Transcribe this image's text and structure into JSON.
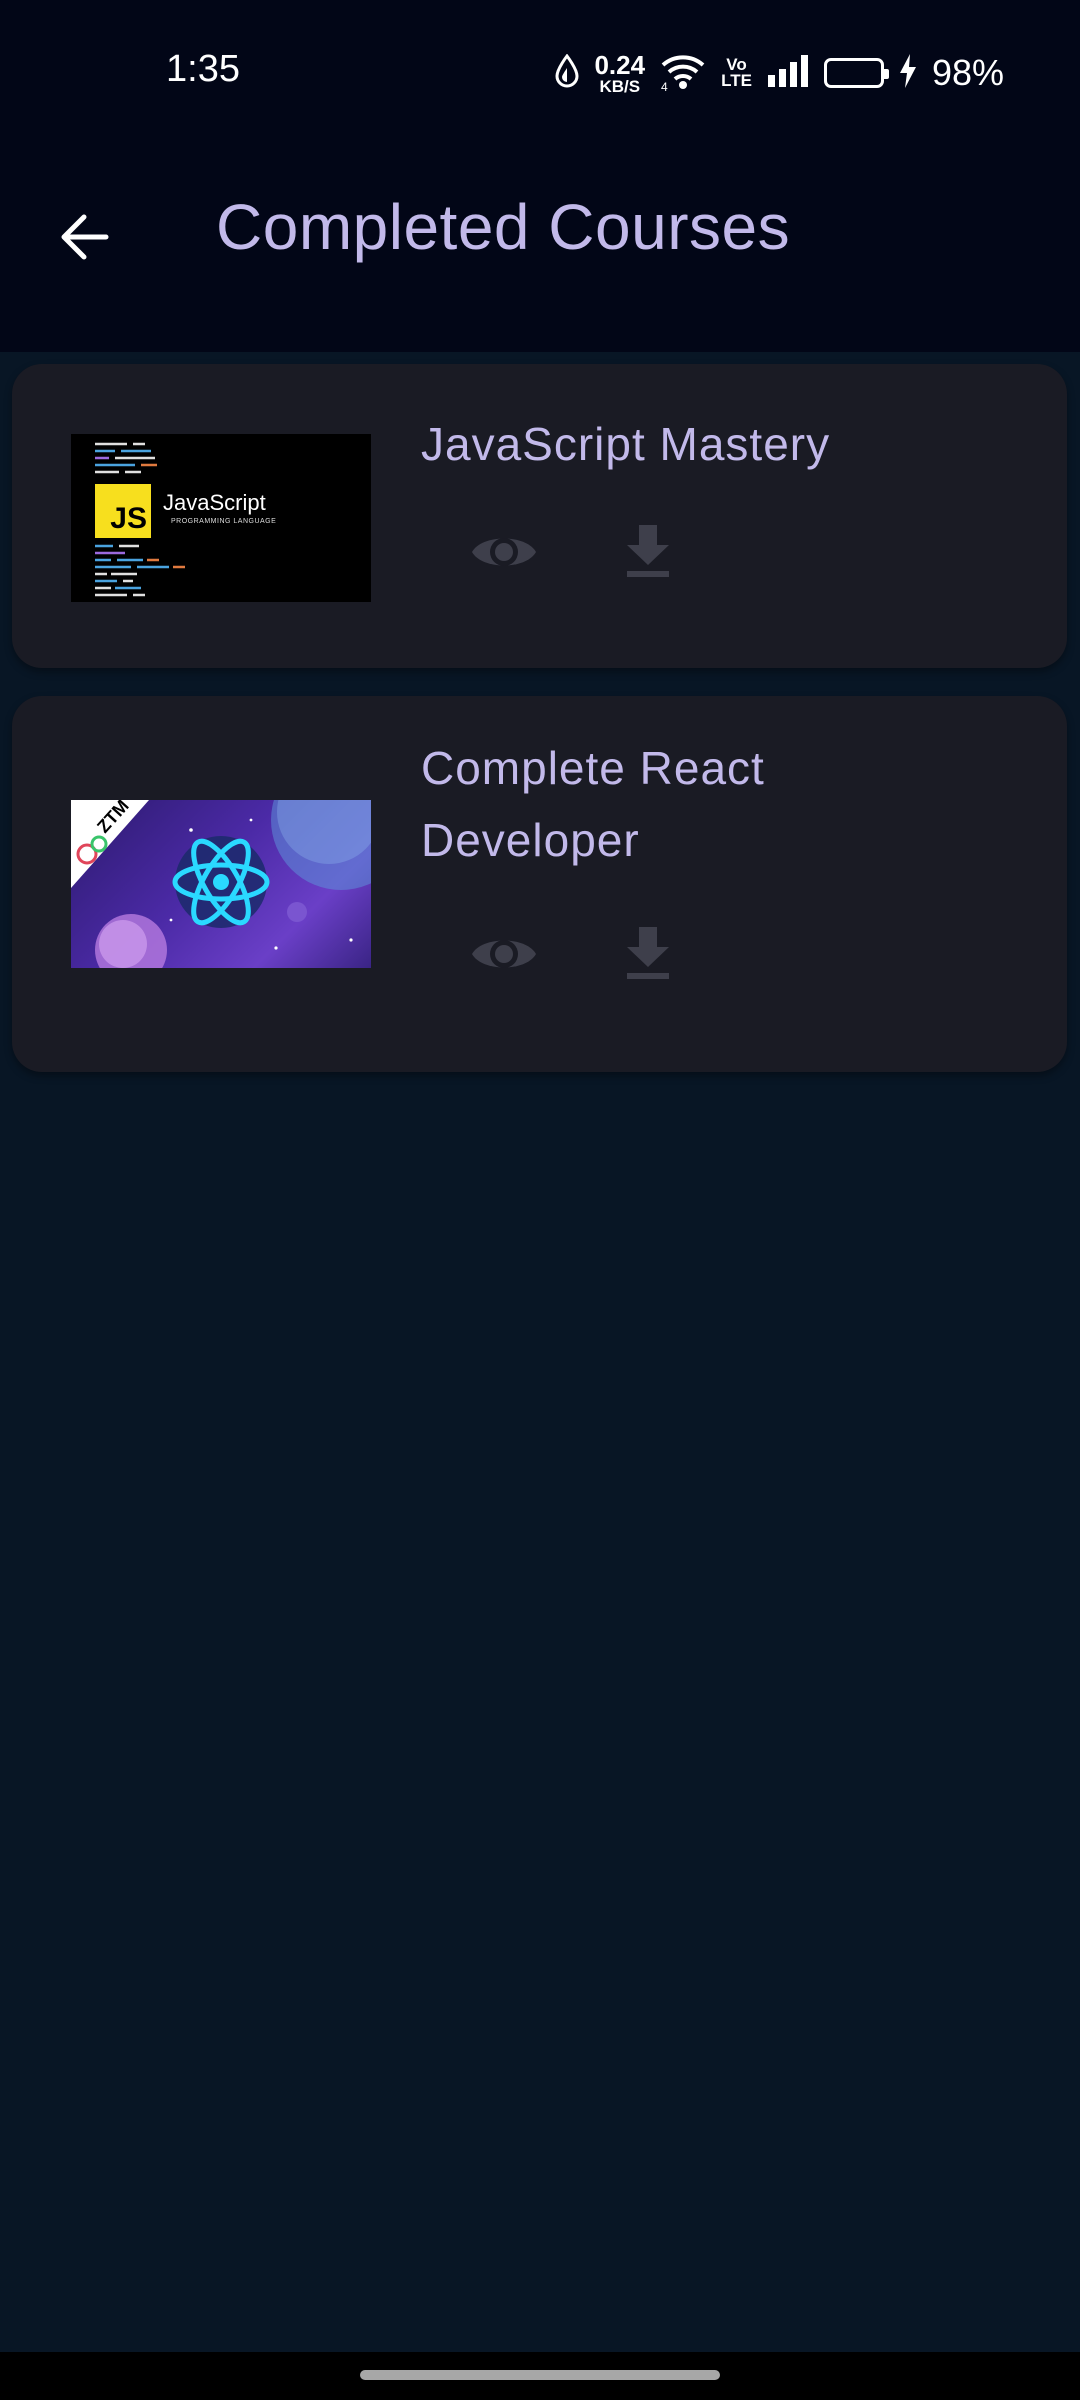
{
  "status_bar": {
    "time": "1:35",
    "net_speed_value": "0.24",
    "net_speed_unit": "KB/S",
    "wifi_sub": "4",
    "volte_top": "Vo",
    "volte_bottom": "LTE",
    "battery_percent": "98%",
    "battery_level": 0.98
  },
  "app_bar": {
    "title": "Completed Courses",
    "back_icon": "arrow-back-icon"
  },
  "courses": [
    {
      "title": "JavaScript Mastery",
      "thumbnail": {
        "badge": "JS",
        "name": "JavaScript",
        "subtitle": "PROGRAMMING LANGUAGE"
      },
      "view_icon": "eye-icon",
      "download_icon": "download-icon"
    },
    {
      "title": "Complete React Developer",
      "thumbnail": {
        "ribbon": "ZTM"
      },
      "view_icon": "eye-icon",
      "download_icon": "download-icon"
    }
  ],
  "colors": {
    "background": "#081625",
    "app_bar": "#020617",
    "card": "#1a1b24",
    "accent_text": "#c2b9ea",
    "icon_muted": "#3e3f4b"
  }
}
